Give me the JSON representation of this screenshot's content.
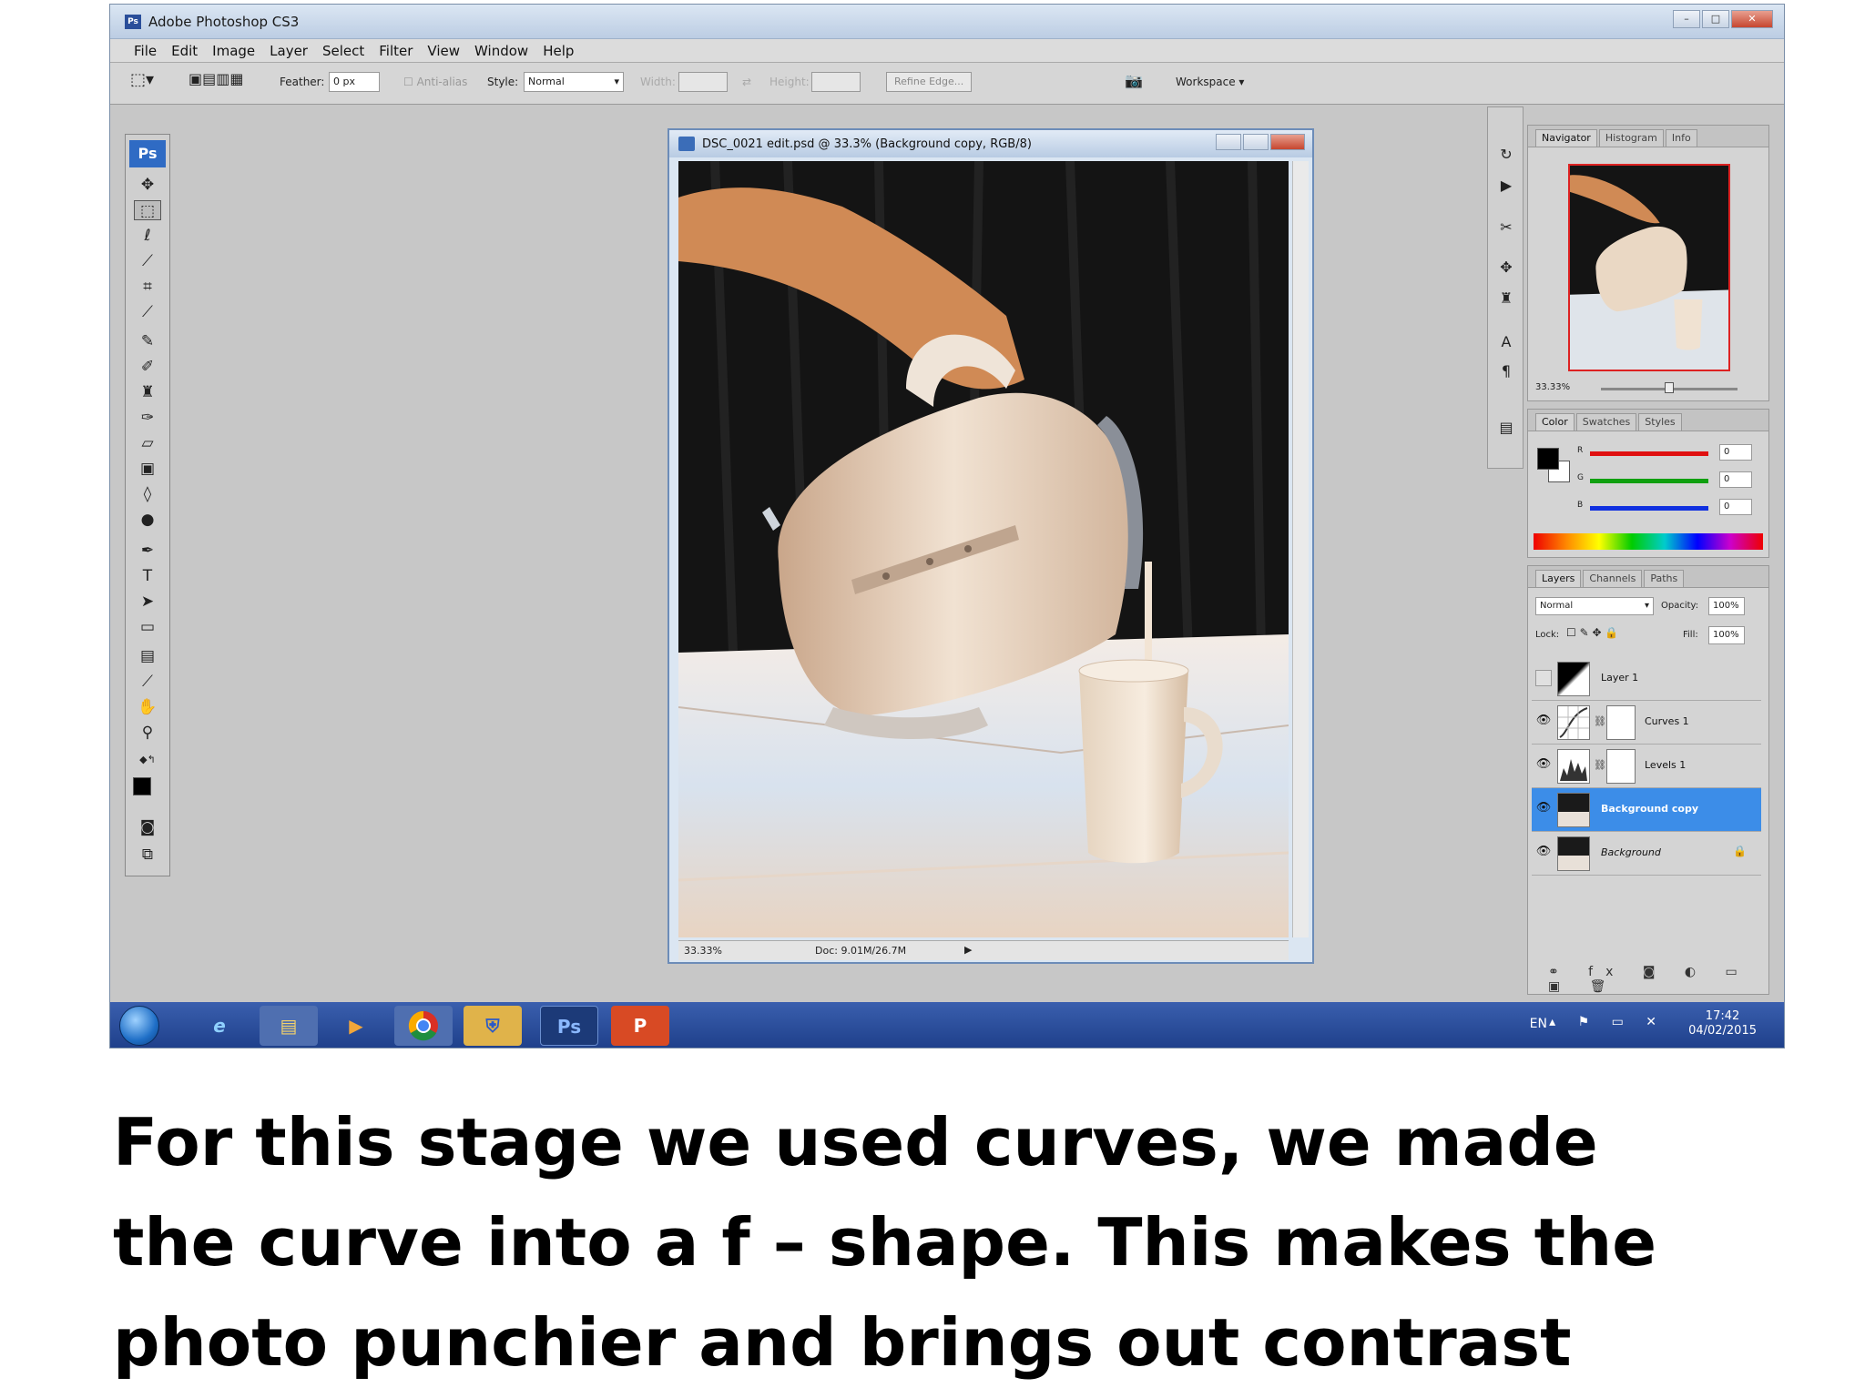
{
  "app": {
    "title": "Adobe Photoshop CS3",
    "logo": "Ps"
  },
  "menu": [
    "File",
    "Edit",
    "Image",
    "Layer",
    "Select",
    "Filter",
    "View",
    "Window",
    "Help"
  ],
  "options": {
    "feather_label": "Feather:",
    "feather_value": "0 px",
    "antialias_label": "Anti-alias",
    "style_label": "Style:",
    "style_value": "Normal",
    "width_label": "Width:",
    "height_label": "Height:",
    "refine_edge": "Refine Edge...",
    "workspace": "Workspace"
  },
  "document": {
    "title": "DSC_0021 edit.psd @ 33.3% (Background copy, RGB/8)",
    "zoom": "33.33%",
    "doc_size": "Doc: 9.01M/26.7M"
  },
  "navigator": {
    "tabs": [
      "Navigator",
      "Histogram",
      "Info"
    ],
    "zoom": "33.33%"
  },
  "color": {
    "tabs": [
      "Color",
      "Swatches",
      "Styles"
    ],
    "channels": [
      {
        "label": "R",
        "value": "0",
        "color": "#e01010"
      },
      {
        "label": "G",
        "value": "0",
        "color": "#10a010"
      },
      {
        "label": "B",
        "value": "0",
        "color": "#1030e0"
      }
    ]
  },
  "layers": {
    "tabs": [
      "Layers",
      "Channels",
      "Paths"
    ],
    "blend_mode": "Normal",
    "opacity_label": "Opacity:",
    "opacity": "100%",
    "lock_label": "Lock:",
    "fill_label": "Fill:",
    "fill": "100%",
    "items": [
      {
        "name": "Layer 1",
        "visible": false,
        "selected": false
      },
      {
        "name": "Curves 1",
        "visible": true,
        "selected": false
      },
      {
        "name": "Levels 1",
        "visible": true,
        "selected": false
      },
      {
        "name": "Background copy",
        "visible": true,
        "selected": true
      },
      {
        "name": "Background",
        "visible": true,
        "selected": false
      }
    ]
  },
  "taskbar": {
    "ps_label": "Ps",
    "pp_label": "P",
    "lang": "EN",
    "time": "17:42",
    "date": "04/02/2015"
  },
  "caption": "For this stage we used curves, we made the curve into a f – shape. This makes the photo punchier and brings out contrast"
}
